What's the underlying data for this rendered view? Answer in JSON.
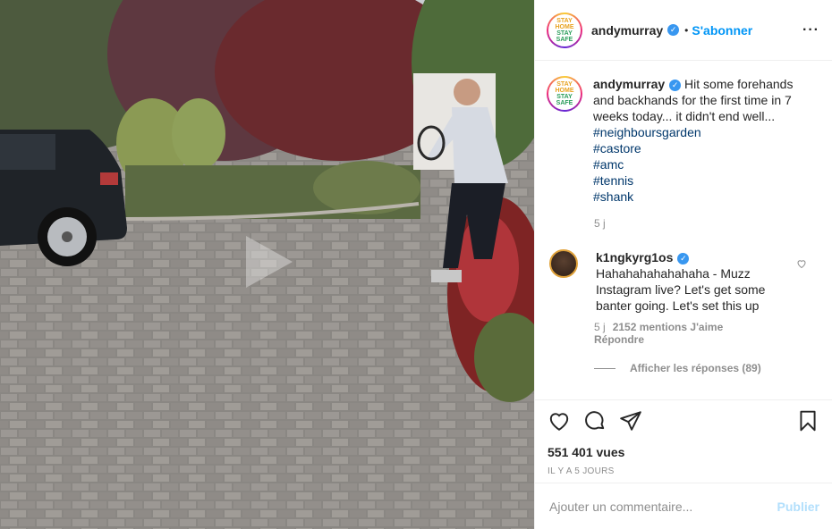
{
  "post": {
    "username": "andymurray",
    "verified_icon": "check-icon",
    "dot": "•",
    "follow_label": "S'abonner",
    "more_icon": "more-horizontal-icon",
    "avatar_lines": [
      "STAY",
      "HOME",
      "STAY",
      "SAFE"
    ],
    "caption": "Hit some forehands and backhands for the first time in 7 weeks today... it didn't end well...",
    "hashtags": [
      "#neighboursgarden",
      "#castore",
      "#amc",
      "#tennis",
      "#shank"
    ],
    "time": "5 j"
  },
  "comment": {
    "username": "k1ngkyrg1os",
    "text": "Hahahahahahahaha - Muzz Instagram live? Let's get some banter going. Let's set this up",
    "time": "5 j",
    "likes": "2152 mentions J'aime",
    "reply": "Répondre",
    "view_replies": "Afficher les réponses (89)"
  },
  "actions": {
    "views": "551 401 vues",
    "ago": "Il y a 5 jours"
  },
  "add_comment": {
    "placeholder": "Ajouter un commentaire...",
    "publish_label": "Publier"
  },
  "colors": {
    "accent": "#0095f6",
    "publish_disabled": "#b2dffc",
    "muted": "#8e8e8e"
  }
}
